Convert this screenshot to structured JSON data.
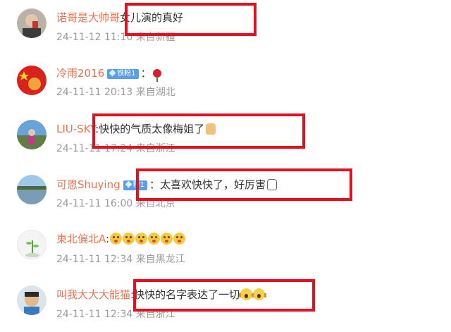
{
  "comments": [
    {
      "user": "诺哥是大帅哥",
      "sep": "",
      "text": "女儿演的真好",
      "time": "24-11-12 11:10",
      "source": "来自新疆",
      "badge": "",
      "avatar_icon": "user-avatar-icon"
    },
    {
      "user": "冷雨2016",
      "sep": "",
      "text": "：",
      "time": "24-11-11 20:13",
      "source": "来自湖北",
      "badge": "铁粉1",
      "avatar_icon": "user-avatar-icon",
      "emoji": "rose-icon"
    },
    {
      "user": "LIU-SKY",
      "sep": ":",
      "text": "快快的气质太像梅姐了",
      "time": "24-11-11 17:24",
      "source": "来自浙江",
      "badge": "",
      "avatar_icon": "user-avatar-icon",
      "emoji": "thumbs-up-icon"
    },
    {
      "user": "可恩Shuying",
      "sep": "",
      "text": "：太喜欢快快了，好厉害",
      "time": "24-11-11 16:00",
      "source": "来自北京",
      "badge": "粉1",
      "avatar_icon": "user-avatar-icon",
      "emoji": "thumbs-up-white-icon"
    },
    {
      "user": "東北偏北A",
      "sep": ":",
      "text": "",
      "time": "24-11-11 12:34",
      "source": "来自黑龙江",
      "badge": "",
      "avatar_icon": "user-avatar-icon",
      "emoji": "blush-face-icon x6"
    },
    {
      "user": "叫我大大大能猫",
      "sep": ":",
      "text": "快快的名字表达了一切",
      "time": "24-11-11 12:34",
      "source": "来自浙江",
      "badge": "",
      "avatar_icon": "user-avatar-icon",
      "emoji": "scream-face-icon x2"
    }
  ],
  "colors": {
    "username": "#eb7350",
    "meta": "#9b9b9b",
    "highlight": "#e3101f",
    "badge": "#5a9ee8"
  }
}
